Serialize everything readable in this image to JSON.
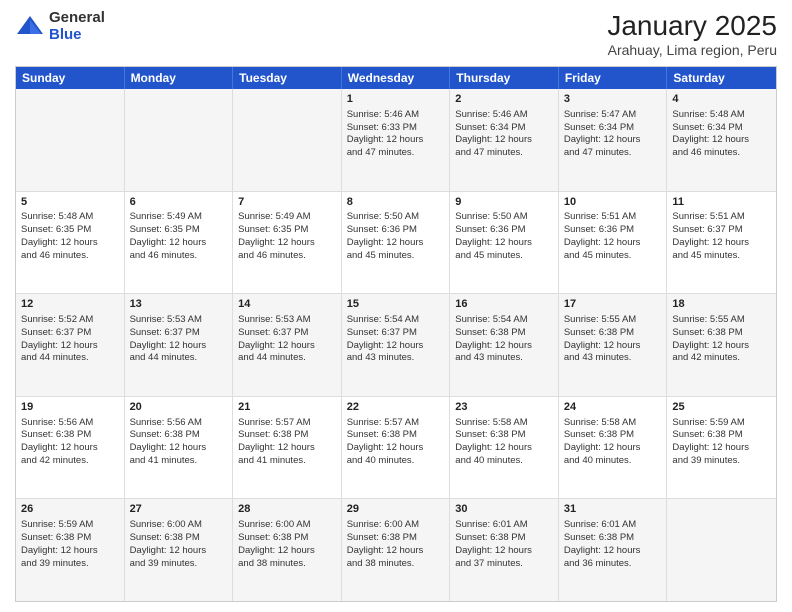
{
  "logo": {
    "general": "General",
    "blue": "Blue"
  },
  "header": {
    "title": "January 2025",
    "subtitle": "Arahuay, Lima region, Peru"
  },
  "days": [
    "Sunday",
    "Monday",
    "Tuesday",
    "Wednesday",
    "Thursday",
    "Friday",
    "Saturday"
  ],
  "weeks": [
    [
      {
        "day": "",
        "lines": []
      },
      {
        "day": "",
        "lines": []
      },
      {
        "day": "",
        "lines": []
      },
      {
        "day": "1",
        "lines": [
          "Sunrise: 5:46 AM",
          "Sunset: 6:33 PM",
          "Daylight: 12 hours",
          "and 47 minutes."
        ]
      },
      {
        "day": "2",
        "lines": [
          "Sunrise: 5:46 AM",
          "Sunset: 6:34 PM",
          "Daylight: 12 hours",
          "and 47 minutes."
        ]
      },
      {
        "day": "3",
        "lines": [
          "Sunrise: 5:47 AM",
          "Sunset: 6:34 PM",
          "Daylight: 12 hours",
          "and 47 minutes."
        ]
      },
      {
        "day": "4",
        "lines": [
          "Sunrise: 5:48 AM",
          "Sunset: 6:34 PM",
          "Daylight: 12 hours",
          "and 46 minutes."
        ]
      }
    ],
    [
      {
        "day": "5",
        "lines": [
          "Sunrise: 5:48 AM",
          "Sunset: 6:35 PM",
          "Daylight: 12 hours",
          "and 46 minutes."
        ]
      },
      {
        "day": "6",
        "lines": [
          "Sunrise: 5:49 AM",
          "Sunset: 6:35 PM",
          "Daylight: 12 hours",
          "and 46 minutes."
        ]
      },
      {
        "day": "7",
        "lines": [
          "Sunrise: 5:49 AM",
          "Sunset: 6:35 PM",
          "Daylight: 12 hours",
          "and 46 minutes."
        ]
      },
      {
        "day": "8",
        "lines": [
          "Sunrise: 5:50 AM",
          "Sunset: 6:36 PM",
          "Daylight: 12 hours",
          "and 45 minutes."
        ]
      },
      {
        "day": "9",
        "lines": [
          "Sunrise: 5:50 AM",
          "Sunset: 6:36 PM",
          "Daylight: 12 hours",
          "and 45 minutes."
        ]
      },
      {
        "day": "10",
        "lines": [
          "Sunrise: 5:51 AM",
          "Sunset: 6:36 PM",
          "Daylight: 12 hours",
          "and 45 minutes."
        ]
      },
      {
        "day": "11",
        "lines": [
          "Sunrise: 5:51 AM",
          "Sunset: 6:37 PM",
          "Daylight: 12 hours",
          "and 45 minutes."
        ]
      }
    ],
    [
      {
        "day": "12",
        "lines": [
          "Sunrise: 5:52 AM",
          "Sunset: 6:37 PM",
          "Daylight: 12 hours",
          "and 44 minutes."
        ]
      },
      {
        "day": "13",
        "lines": [
          "Sunrise: 5:53 AM",
          "Sunset: 6:37 PM",
          "Daylight: 12 hours",
          "and 44 minutes."
        ]
      },
      {
        "day": "14",
        "lines": [
          "Sunrise: 5:53 AM",
          "Sunset: 6:37 PM",
          "Daylight: 12 hours",
          "and 44 minutes."
        ]
      },
      {
        "day": "15",
        "lines": [
          "Sunrise: 5:54 AM",
          "Sunset: 6:37 PM",
          "Daylight: 12 hours",
          "and 43 minutes."
        ]
      },
      {
        "day": "16",
        "lines": [
          "Sunrise: 5:54 AM",
          "Sunset: 6:38 PM",
          "Daylight: 12 hours",
          "and 43 minutes."
        ]
      },
      {
        "day": "17",
        "lines": [
          "Sunrise: 5:55 AM",
          "Sunset: 6:38 PM",
          "Daylight: 12 hours",
          "and 43 minutes."
        ]
      },
      {
        "day": "18",
        "lines": [
          "Sunrise: 5:55 AM",
          "Sunset: 6:38 PM",
          "Daylight: 12 hours",
          "and 42 minutes."
        ]
      }
    ],
    [
      {
        "day": "19",
        "lines": [
          "Sunrise: 5:56 AM",
          "Sunset: 6:38 PM",
          "Daylight: 12 hours",
          "and 42 minutes."
        ]
      },
      {
        "day": "20",
        "lines": [
          "Sunrise: 5:56 AM",
          "Sunset: 6:38 PM",
          "Daylight: 12 hours",
          "and 41 minutes."
        ]
      },
      {
        "day": "21",
        "lines": [
          "Sunrise: 5:57 AM",
          "Sunset: 6:38 PM",
          "Daylight: 12 hours",
          "and 41 minutes."
        ]
      },
      {
        "day": "22",
        "lines": [
          "Sunrise: 5:57 AM",
          "Sunset: 6:38 PM",
          "Daylight: 12 hours",
          "and 40 minutes."
        ]
      },
      {
        "day": "23",
        "lines": [
          "Sunrise: 5:58 AM",
          "Sunset: 6:38 PM",
          "Daylight: 12 hours",
          "and 40 minutes."
        ]
      },
      {
        "day": "24",
        "lines": [
          "Sunrise: 5:58 AM",
          "Sunset: 6:38 PM",
          "Daylight: 12 hours",
          "and 40 minutes."
        ]
      },
      {
        "day": "25",
        "lines": [
          "Sunrise: 5:59 AM",
          "Sunset: 6:38 PM",
          "Daylight: 12 hours",
          "and 39 minutes."
        ]
      }
    ],
    [
      {
        "day": "26",
        "lines": [
          "Sunrise: 5:59 AM",
          "Sunset: 6:38 PM",
          "Daylight: 12 hours",
          "and 39 minutes."
        ]
      },
      {
        "day": "27",
        "lines": [
          "Sunrise: 6:00 AM",
          "Sunset: 6:38 PM",
          "Daylight: 12 hours",
          "and 39 minutes."
        ]
      },
      {
        "day": "28",
        "lines": [
          "Sunrise: 6:00 AM",
          "Sunset: 6:38 PM",
          "Daylight: 12 hours",
          "and 38 minutes."
        ]
      },
      {
        "day": "29",
        "lines": [
          "Sunrise: 6:00 AM",
          "Sunset: 6:38 PM",
          "Daylight: 12 hours",
          "and 38 minutes."
        ]
      },
      {
        "day": "30",
        "lines": [
          "Sunrise: 6:01 AM",
          "Sunset: 6:38 PM",
          "Daylight: 12 hours",
          "and 37 minutes."
        ]
      },
      {
        "day": "31",
        "lines": [
          "Sunrise: 6:01 AM",
          "Sunset: 6:38 PM",
          "Daylight: 12 hours",
          "and 36 minutes."
        ]
      },
      {
        "day": "",
        "lines": []
      }
    ]
  ]
}
